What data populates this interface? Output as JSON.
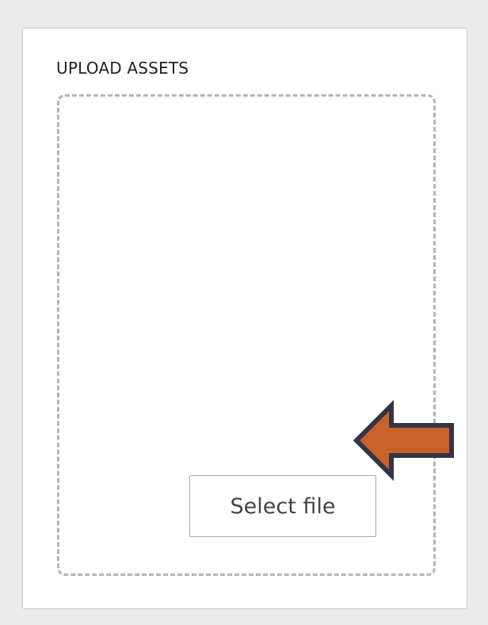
{
  "upload": {
    "title": "UPLOAD ASSETS",
    "select_button_label": "Select file"
  },
  "annotation": {
    "arrow_icon": "left-arrow-icon",
    "arrow_color": "#c8612a",
    "arrow_outline": "#343447"
  },
  "colors": {
    "page_background": "#ececec",
    "panel_background": "#ffffff",
    "dropzone_border": "#b5b5b5"
  }
}
